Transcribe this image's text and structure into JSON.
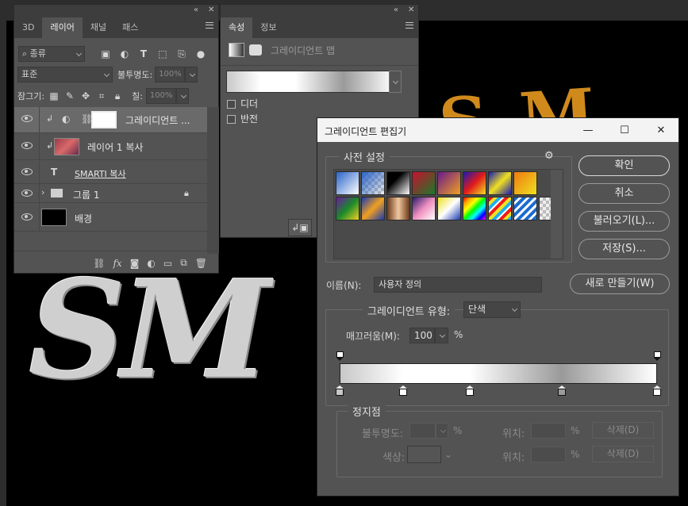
{
  "canvas": {
    "gold_text": "SM",
    "silver_text": "SM"
  },
  "layers_panel": {
    "tabs": [
      {
        "label": "3D"
      },
      {
        "label": "레이어"
      },
      {
        "label": "채널"
      },
      {
        "label": "패스"
      }
    ],
    "active_tab": "레이어",
    "filter": {
      "label": "종류"
    },
    "blend_mode": "표준",
    "opacity_label": "불투명도:",
    "opacity_value": "100%",
    "lock_label": "잠그기:",
    "fill_label": "칠:",
    "fill_value": "100%",
    "layers": [
      {
        "name": "그레이디언트 ...",
        "type": "gradient-fill"
      },
      {
        "name": "레이어 1 복사",
        "type": "pixel"
      },
      {
        "name": "SMARTI 복사",
        "type": "text"
      },
      {
        "name": "그룹 1",
        "type": "group"
      },
      {
        "name": "배경",
        "type": "background"
      }
    ],
    "bottom_icons": [
      "link-icon",
      "fx-icon",
      "mask-icon",
      "adjustment-icon",
      "folder-icon",
      "new-layer-icon",
      "trash-icon"
    ]
  },
  "properties_panel": {
    "tabs": [
      {
        "label": "속성"
      },
      {
        "label": "정보"
      }
    ],
    "subtitle": "그레이디언트 맵",
    "dither_label": "디더",
    "reverse_label": "반전"
  },
  "gradient_editor": {
    "title": "그레이디언트 편집기",
    "presets_label": "사전 설정",
    "buttons": {
      "ok": "확인",
      "cancel": "취소",
      "load": "불러오기(L)...",
      "save": "저장(S)...",
      "new": "새로 만들기(W)"
    },
    "name_label": "이름(N):",
    "name_value": "사용자 정의",
    "type_label": "그레이디언트 유형:",
    "type_value": "단색",
    "smoothness_label": "매끄러움(M):",
    "smoothness_value": "100",
    "smoothness_unit": "%",
    "stops_label": "정지점",
    "stop_opacity_label": "불투명도:",
    "stop_color_label": "색상:",
    "location_label": "위치:",
    "percent": "%",
    "delete_label": "삭제(D)",
    "color_stops": [
      {
        "position": 0,
        "color": "#c8c8c8"
      },
      {
        "position": 20,
        "color": "#ffffff"
      },
      {
        "position": 41,
        "color": "#ffffff"
      },
      {
        "position": 70,
        "color": "#9a9a9a"
      },
      {
        "position": 100,
        "color": "#ffffff"
      }
    ],
    "opacity_stops": [
      {
        "position": 0
      },
      {
        "position": 100
      }
    ]
  }
}
